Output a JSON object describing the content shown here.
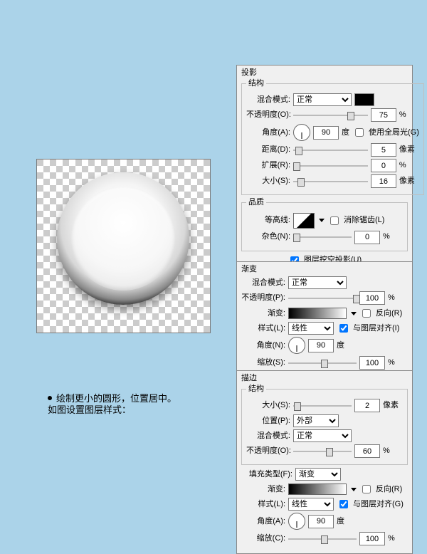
{
  "caption": {
    "line1": "绘制更小的圆形，位置居中。",
    "line2": "如图设置图层样式："
  },
  "shadow": {
    "title": "投影",
    "struct": "结构",
    "blend_lbl": "混合模式:",
    "blend_val": "正常",
    "opacity_lbl": "不透明度(O):",
    "opacity_val": "75",
    "pct": "%",
    "angle_lbl": "角度(A):",
    "angle_val": "90",
    "degree": "度",
    "global_lbl": "使用全局光(G)",
    "dist_lbl": "距离(D):",
    "dist_val": "5",
    "px": "像素",
    "spread_lbl": "扩展(R):",
    "spread_val": "0",
    "size_lbl": "大小(S):",
    "size_val": "16",
    "quality": "品质",
    "contour_lbl": "等高线:",
    "antialias_lbl": "消除锯齿(L)",
    "noise_lbl": "杂色(N):",
    "noise_val": "0",
    "knockout_lbl": "图层挖空投影(U)"
  },
  "gradient": {
    "title": "渐变",
    "blend_lbl": "混合模式:",
    "blend_val": "正常",
    "opacity_lbl": "不透明度(P):",
    "opacity_val": "100",
    "pct": "%",
    "grad_lbl": "渐变:",
    "reverse_lbl": "反向(R)",
    "style_lbl": "样式(L):",
    "style_val": "线性",
    "align_lbl": "与图层对齐(I)",
    "angle_lbl": "角度(N):",
    "angle_val": "90",
    "degree": "度",
    "scale_lbl": "缩放(S):",
    "scale_val": "100"
  },
  "stroke": {
    "title": "描边",
    "struct": "结构",
    "size_lbl": "大小(S):",
    "size_val": "2",
    "px": "像素",
    "pos_lbl": "位置(P):",
    "pos_val": "外部",
    "blend_lbl": "混合模式:",
    "blend_val": "正常",
    "opacity_lbl": "不透明度(O):",
    "opacity_val": "60",
    "pct": "%",
    "fill_lbl": "填充类型(F):",
    "fill_val": "渐变",
    "grad_lbl": "渐变:",
    "reverse_lbl": "反向(R)",
    "style_lbl": "样式(L):",
    "style_val": "线性",
    "align_lbl": "与图层对齐(G)",
    "angle_lbl": "角度(A):",
    "angle_val": "90",
    "degree": "度",
    "scale_lbl": "缩放(C):",
    "scale_val": "100"
  }
}
